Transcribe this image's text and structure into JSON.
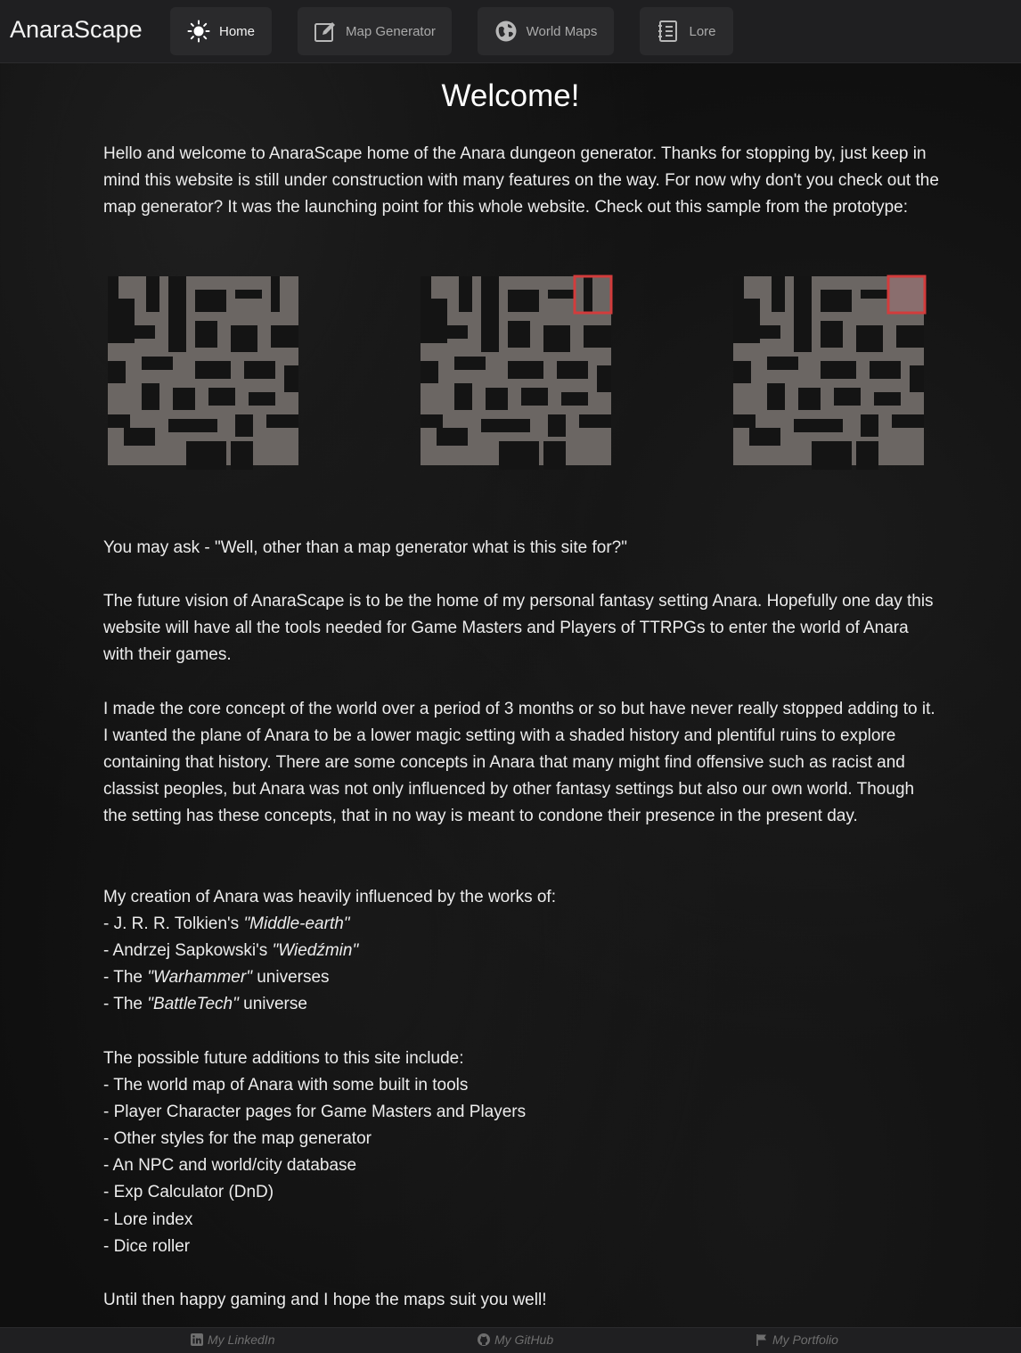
{
  "brand": "AnaraScape",
  "nav": {
    "home": "Home",
    "map_generator": "Map Generator",
    "world_maps": "World Maps",
    "lore": "Lore"
  },
  "title": "Welcome!",
  "intro": "Hello and welcome to AnaraScape home of the Anara dungeon generator. Thanks for stopping by, just keep in mind this website is still under construction with many features on the way. For now why don't you check out the map generator? It was the launching point for this whole website. Check out this sample from the prototype:",
  "question": "You may ask - \"Well, other than a map generator what is this site for?\"",
  "vision": "The future vision of AnaraScape is to be the home of my personal fantasy setting Anara. Hopefully one day this website will have all the tools needed for Game Masters and Players of TTRPGs to enter the world of Anara with their games.",
  "concept": "I made the core concept of the world over a period of 3 months or so but have never really stopped adding to it. I wanted the plane of Anara to be a lower magic setting with a shaded history and plentiful ruins to explore containing that history. There are some concepts in Anara that many might find offensive such as racist and classist peoples, but Anara was not only influenced by other fantasy settings but also our own world. Though the setting has these concepts, that in no way is meant to condone their presence in the present day.",
  "influences": {
    "heading": "My creation of Anara was heavily influenced by the works of:",
    "items": [
      {
        "prefix": "- J. R. R. Tolkien's ",
        "work": "\"Middle-earth\"",
        "suffix": ""
      },
      {
        "prefix": "- Andrzej Sapkowski's ",
        "work": "\"Wiedźmin\"",
        "suffix": ""
      },
      {
        "prefix": "- The ",
        "work": "\"Warhammer\"",
        "suffix": " universes"
      },
      {
        "prefix": "- The ",
        "work": "\"BattleTech\"",
        "suffix": " universe"
      }
    ]
  },
  "additions": {
    "heading": "The possible future additions to this site include:",
    "items": [
      "- The world map of Anara with some built in tools",
      "- Player Character pages for Game Masters and Players",
      "- Other styles for the map generator",
      "- An NPC and world/city database",
      "- Exp Calculator (DnD)",
      "- Lore index",
      "- Dice roller"
    ]
  },
  "closing": "Until then happy gaming and I hope the maps suit you well!",
  "footer": {
    "linkedin": "My LinkedIn",
    "github": "My GitHub",
    "portfolio": "My Portfolio"
  },
  "colors": {
    "floor": "#6b6663",
    "highlight": "#d23c3c",
    "nav_bg": "#1f1f21",
    "button_bg": "#2a2a2c"
  },
  "icons": {
    "home": "sun-icon",
    "map_generator": "edit-icon",
    "world_maps": "globe-icon",
    "lore": "notebook-icon",
    "linkedin": "linkedin-icon",
    "github": "github-icon",
    "portfolio": "flag-icon"
  }
}
